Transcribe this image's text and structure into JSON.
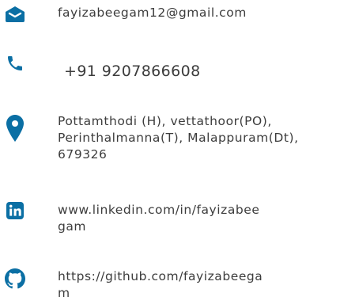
{
  "accent_color": "#0b6fa4",
  "contacts": [
    {
      "icon": "envelope-icon",
      "text": "fayizabeegam12@gmail.com"
    },
    {
      "icon": "phone-icon",
      "text": "+91 9207866608"
    },
    {
      "icon": "location-pin-icon",
      "text": "Pottamthodi (H), vettathoor(PO),\nPerinthalmanna(T), Malappuram(Dt),\n679326"
    },
    {
      "icon": "linkedin-icon",
      "text": "www.linkedin.com/in/fayizabee\ngam"
    },
    {
      "icon": "github-icon",
      "text": "https://github.com/fayizabeega\nm"
    }
  ]
}
